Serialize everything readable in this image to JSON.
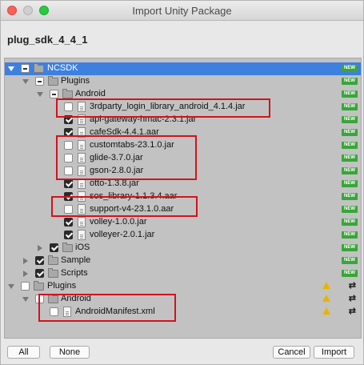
{
  "window": {
    "title": "Import Unity Package"
  },
  "package": {
    "name": "plug_sdk_4_4_1"
  },
  "badges": {
    "new": "NEW",
    "swap": "⇄"
  },
  "tree": {
    "ncsdk": "NCSDK",
    "plugins": "Plugins",
    "android": "Android",
    "items": [
      "3rdparty_login_library_android_4.1.4.jar",
      "api-gateway-hmac-2.3.1.jar",
      "cafeSdk-4.4.1.aar",
      "customtabs-23.1.0.jar",
      "glide-3.7.0.jar",
      "gson-2.8.0.jar",
      "otto-1.3.8.jar",
      "sos_library-1.1.3.4.aar",
      "support-v4-23.1.0.aar",
      "volley-1.0.0.jar",
      "volleyer-2.0.1.jar"
    ],
    "ios": "iOS",
    "sample": "Sample",
    "scripts": "Scripts",
    "root_plugins": "Plugins",
    "root_android": "Android",
    "manifest": "AndroidManifest.xml"
  },
  "buttons": {
    "all": "All",
    "none": "None",
    "cancel": "Cancel",
    "import": "Import"
  },
  "colors": {
    "selection": "#3d80df",
    "new_badge": "#3aa53a",
    "highlight_box": "#d3121d",
    "warning": "#e8b400"
  }
}
